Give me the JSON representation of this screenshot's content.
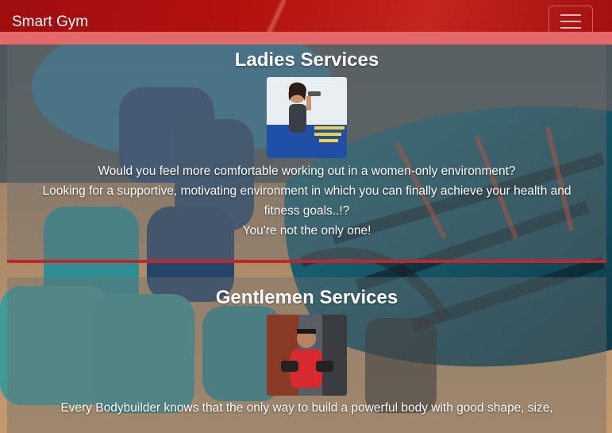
{
  "navbar": {
    "brand": "Smart Gym",
    "toggle_icon": "hamburger-menu-icon"
  },
  "ladies": {
    "title": "Ladies Services",
    "image_alt": "woman with dumbbell",
    "lines": [
      "Would you feel more comfortable working out in a women-only environment?",
      "Looking for a supportive, motivating environment in which you can finally achieve your health and fitness goals..!?",
      "You're not the only one!"
    ]
  },
  "gents": {
    "title": "Gentlemen Services",
    "image_alt": "man lifting dumbbells",
    "lines": [
      "Every Bodybuilder knows that the only way to build a powerful body with good shape, size,"
    ]
  },
  "colors": {
    "navbar": "#b3120f",
    "underline": "#e46a6a",
    "divider": "#c0262a"
  }
}
